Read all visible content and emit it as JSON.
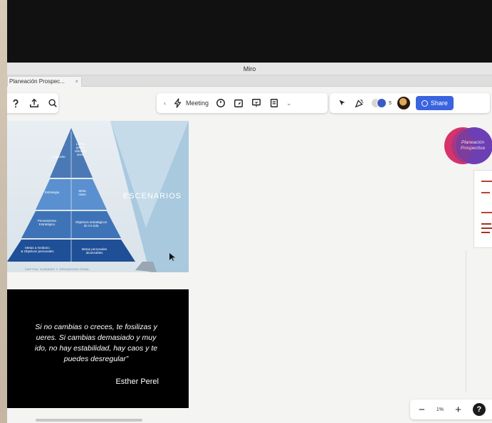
{
  "window": {
    "title": "Miro"
  },
  "tabs": [
    {
      "label": "Planeación Prospec...",
      "close": "×"
    }
  ],
  "toolbar_left": {
    "icons": [
      "question-icon",
      "upload-icon",
      "search-icon"
    ]
  },
  "toolbar_mid": {
    "meeting_label": "Meeting",
    "chevron": "‹",
    "more": "⌄"
  },
  "toolbar_right": {
    "collaborator_count": "5",
    "share_label": "Share",
    "accent": "#3a63e0"
  },
  "slide_pyramid": {
    "scenario_label": "ESCENARIOS",
    "levels": [
      {
        "left": "Propósito",
        "right": "Lorem ipsum\ndolor sit\namet"
      },
      {
        "left": "Estrategia",
        "right": "Meta\nclave"
      },
      {
        "left": "Pensamiento\nEstratégico",
        "right": "Objetivos estratégicos\nde mi vida"
      },
      {
        "left": "Metas a mediano\n& Objetivos personales",
        "right": "Metas personales\nalcanzables"
      }
    ],
    "caption": "CAPITAL HUMANO Y ORGANIZACIONAL"
  },
  "slide_quote": {
    "lines": [
      "Si no cambias o creces, te fosilizas y",
      "ueres. Si cambias demasiado y muy",
      "ido, no hay estabilidad, hay caos y te",
      "puedes desregular”"
    ],
    "author": "Esther Perel"
  },
  "planeacion_bubble": {
    "label": "Planeación\nProspectiva",
    "colors": [
      "#d6336c",
      "#6c3fb5"
    ]
  },
  "zoom": {
    "minus": "−",
    "value": "1%",
    "plus": "+",
    "help": "?"
  }
}
